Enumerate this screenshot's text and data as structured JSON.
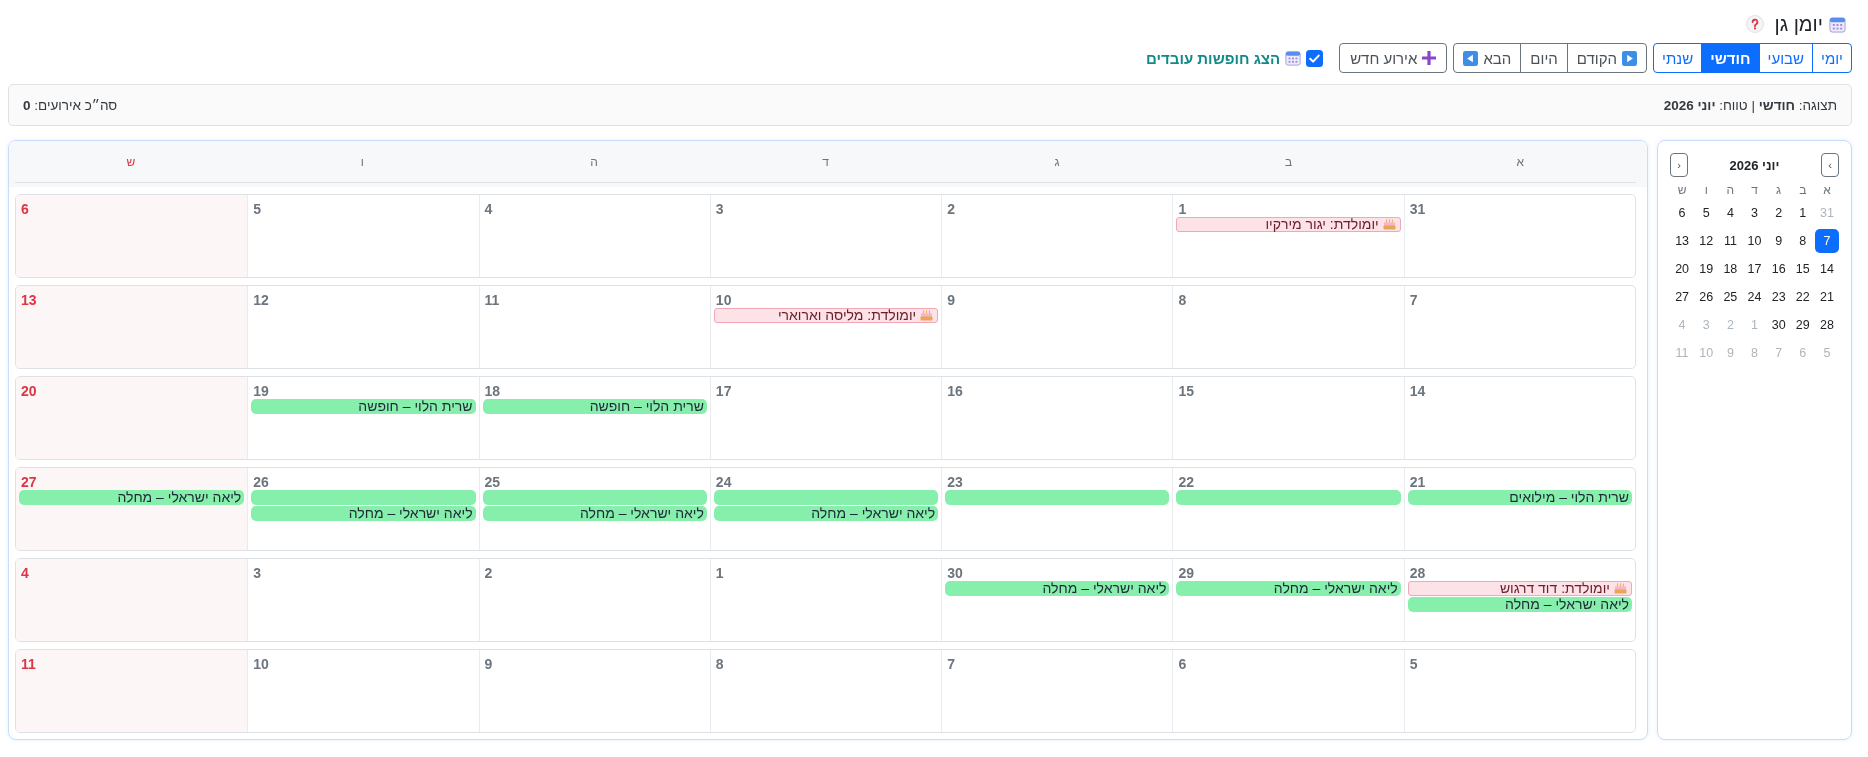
{
  "header": {
    "title": "יומן גן"
  },
  "toolbar": {
    "views": [
      {
        "label": "יומי",
        "selected": false
      },
      {
        "label": "שבועי",
        "selected": false
      },
      {
        "label": "חודשי",
        "selected": true
      },
      {
        "label": "שנתי",
        "selected": false
      }
    ],
    "nav": [
      {
        "label": "הקודם",
        "kind": "prev"
      },
      {
        "label": "היום",
        "kind": "today"
      },
      {
        "label": "הבא",
        "kind": "next"
      }
    ],
    "new_event": {
      "label": "אירוע חדש"
    },
    "show_leaves": {
      "label": "הצג חופשות עובדים",
      "checked": true
    }
  },
  "info_bar": {
    "view": "תצוגה: **חודשי** | טווח: **יוני 2026**",
    "total": "סה״כ אירועים: **0**"
  },
  "mini_calendar": {
    "title": "יוני 2026",
    "nav_buttons": [
      "‹",
      "›"
    ],
    "weekdays": [
      "א",
      "ב",
      "ג",
      "ד",
      "ה",
      "ו",
      "ש"
    ],
    "weeks": [
      {
        "days": [
          {
            "number": "31",
            "muted": true,
            "selected": false
          },
          {
            "number": "1",
            "muted": false,
            "selected": false
          },
          {
            "number": "2",
            "muted": false,
            "selected": false
          },
          {
            "number": "3",
            "muted": false,
            "selected": false
          },
          {
            "number": "4",
            "muted": false,
            "selected": false
          },
          {
            "number": "5",
            "muted": false,
            "selected": false
          },
          {
            "number": "6",
            "muted": false,
            "selected": false
          }
        ]
      },
      {
        "days": [
          {
            "number": "7",
            "muted": false,
            "selected": true
          },
          {
            "number": "8",
            "muted": false,
            "selected": false
          },
          {
            "number": "9",
            "muted": false,
            "selected": false
          },
          {
            "number": "10",
            "muted": false,
            "selected": false
          },
          {
            "number": "11",
            "muted": false,
            "selected": false
          },
          {
            "number": "12",
            "muted": false,
            "selected": false
          },
          {
            "number": "13",
            "muted": false,
            "selected": false
          }
        ]
      },
      {
        "days": [
          {
            "number": "14",
            "muted": false,
            "selected": false
          },
          {
            "number": "15",
            "muted": false,
            "selected": false
          },
          {
            "number": "16",
            "muted": false,
            "selected": false
          },
          {
            "number": "17",
            "muted": false,
            "selected": false
          },
          {
            "number": "18",
            "muted": false,
            "selected": false
          },
          {
            "number": "19",
            "muted": false,
            "selected": false
          },
          {
            "number": "20",
            "muted": false,
            "selected": false
          }
        ]
      },
      {
        "days": [
          {
            "number": "21",
            "muted": false,
            "selected": false
          },
          {
            "number": "22",
            "muted": false,
            "selected": false
          },
          {
            "number": "23",
            "muted": false,
            "selected": false
          },
          {
            "number": "24",
            "muted": false,
            "selected": false
          },
          {
            "number": "25",
            "muted": false,
            "selected": false
          },
          {
            "number": "26",
            "muted": false,
            "selected": false
          },
          {
            "number": "27",
            "muted": false,
            "selected": false
          }
        ]
      },
      {
        "days": [
          {
            "number": "28",
            "muted": false,
            "selected": false
          },
          {
            "number": "29",
            "muted": false,
            "selected": false
          },
          {
            "number": "30",
            "muted": false,
            "selected": false
          },
          {
            "number": "1",
            "muted": true,
            "selected": false
          },
          {
            "number": "2",
            "muted": true,
            "selected": false
          },
          {
            "number": "3",
            "muted": true,
            "selected": false
          },
          {
            "number": "4",
            "muted": true,
            "selected": false
          }
        ]
      },
      {
        "days": [
          {
            "number": "5",
            "muted": true,
            "selected": false
          },
          {
            "number": "6",
            "muted": true,
            "selected": false
          },
          {
            "number": "7",
            "muted": true,
            "selected": false
          },
          {
            "number": "8",
            "muted": true,
            "selected": false
          },
          {
            "number": "9",
            "muted": true,
            "selected": false
          },
          {
            "number": "10",
            "muted": true,
            "selected": false
          },
          {
            "number": "11",
            "muted": true,
            "selected": false
          }
        ]
      }
    ]
  },
  "calendar": {
    "weekdays": [
      {
        "label": "א",
        "weekend": false
      },
      {
        "label": "ב",
        "weekend": false
      },
      {
        "label": "ג",
        "weekend": false
      },
      {
        "label": "ד",
        "weekend": false
      },
      {
        "label": "ה",
        "weekend": false
      },
      {
        "label": "ו",
        "weekend": false
      },
      {
        "label": "ש",
        "weekend": true
      }
    ],
    "weeks": [
      {
        "days": [
          {
            "number": "31"
          },
          {
            "number": "1",
            "events": [
              {
                "kind": "birthday",
                "text": "יומולדת: יגור מירקיו"
              }
            ]
          },
          {
            "number": "2"
          },
          {
            "number": "3"
          },
          {
            "number": "4"
          },
          {
            "number": "5"
          },
          {
            "number": "6"
          }
        ]
      },
      {
        "days": [
          {
            "number": "7"
          },
          {
            "number": "8"
          },
          {
            "number": "9"
          },
          {
            "number": "10",
            "events": [
              {
                "kind": "birthday",
                "text": "יומולדת: מליסה וארוארי"
              }
            ]
          },
          {
            "number": "11"
          },
          {
            "number": "12"
          },
          {
            "number": "13"
          }
        ]
      },
      {
        "days": [
          {
            "number": "14"
          },
          {
            "number": "15"
          },
          {
            "number": "16"
          },
          {
            "number": "17"
          },
          {
            "number": "18",
            "events": [
              {
                "kind": "leave",
                "text": "שרית הלוי – חופשה"
              }
            ]
          },
          {
            "number": "19",
            "events": [
              {
                "kind": "leave",
                "text": "שרית הלוי – חופשה"
              }
            ]
          },
          {
            "number": "20"
          }
        ]
      },
      {
        "days": [
          {
            "number": "21",
            "events": [
              {
                "kind": "leave",
                "text": "שרית הלוי – מילואים"
              }
            ]
          },
          {
            "number": "22",
            "events": [
              {
                "kind": "leave"
              }
            ]
          },
          {
            "number": "23",
            "events": [
              {
                "kind": "leave"
              }
            ]
          },
          {
            "number": "24",
            "events": [
              {
                "kind": "leave"
              },
              {
                "kind": "leave",
                "text": "ליאה ישראלי – מחלה"
              }
            ]
          },
          {
            "number": "25",
            "events": [
              {
                "kind": "leave"
              },
              {
                "kind": "leave",
                "text": "ליאה ישראלי – מחלה"
              }
            ]
          },
          {
            "number": "26",
            "events": [
              {
                "kind": "leave"
              },
              {
                "kind": "leave",
                "text": "ליאה ישראלי – מחלה"
              }
            ]
          },
          {
            "number": "27",
            "events": [
              {
                "kind": "leave",
                "text": "ליאה ישראלי – מחלה"
              }
            ]
          }
        ]
      },
      {
        "days": [
          {
            "number": "28",
            "events": [
              {
                "kind": "birthday",
                "text": "יומולדת: דוד דרגוש"
              },
              {
                "kind": "leave",
                "text": "ליאה ישראלי – מחלה"
              }
            ]
          },
          {
            "number": "29",
            "events": [
              {
                "kind": "leave",
                "text": "ליאה ישראלי – מחלה"
              }
            ]
          },
          {
            "number": "30",
            "events": [
              {
                "kind": "leave",
                "text": "ליאה ישראלי – מחלה"
              }
            ]
          },
          {
            "number": "1"
          },
          {
            "number": "2"
          },
          {
            "number": "3"
          },
          {
            "number": "4"
          }
        ]
      },
      {
        "days": [
          {
            "number": "5"
          },
          {
            "number": "6"
          },
          {
            "number": "7"
          },
          {
            "number": "8"
          },
          {
            "number": "9"
          },
          {
            "number": "10"
          },
          {
            "number": "11"
          }
        ]
      }
    ]
  }
}
